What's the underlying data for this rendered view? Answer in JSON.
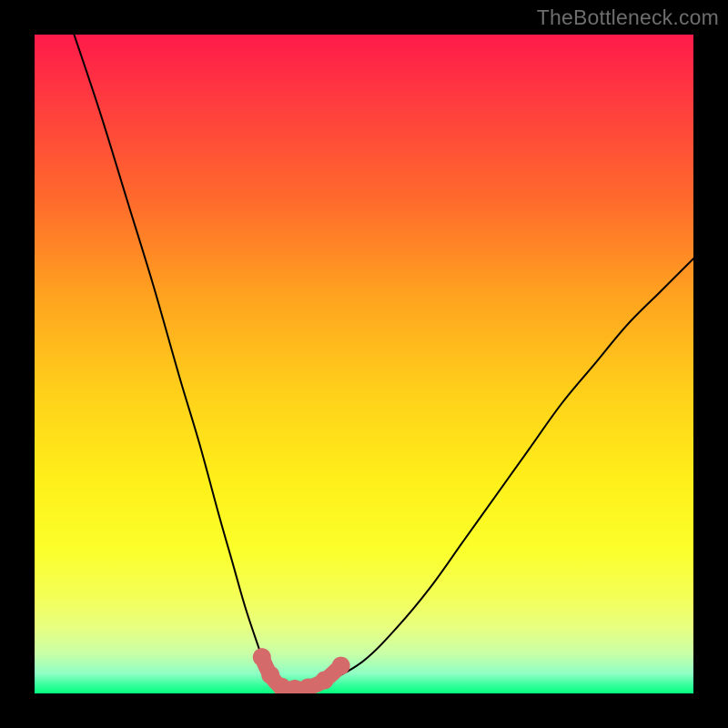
{
  "watermark": "TheBottleneck.com",
  "chart_data": {
    "type": "line",
    "title": "",
    "xlabel": "",
    "ylabel": "",
    "xlim": [
      0,
      100
    ],
    "ylim": [
      0,
      100
    ],
    "series": [
      {
        "name": "bottleneck-curve",
        "x": [
          6,
          10,
          14,
          18,
          22,
          25,
          28,
          30,
          32,
          34,
          35,
          36,
          37,
          38,
          40,
          42,
          43,
          45,
          50,
          55,
          60,
          65,
          70,
          75,
          80,
          85,
          90,
          95,
          100
        ],
        "y": [
          100,
          88,
          75,
          62,
          48,
          38,
          27,
          20,
          13,
          7,
          4,
          2,
          1,
          0.5,
          0.5,
          0.8,
          1.2,
          2,
          5,
          10,
          16,
          23,
          30,
          37,
          44,
          50,
          56,
          61,
          66
        ]
      }
    ],
    "markers": [
      {
        "name": "marker-left-1",
        "x": 34.5,
        "y": 5.5
      },
      {
        "name": "marker-left-2",
        "x": 35.8,
        "y": 2.8
      },
      {
        "name": "marker-bottom-1",
        "x": 37.5,
        "y": 1.0
      },
      {
        "name": "marker-bottom-2",
        "x": 39.5,
        "y": 0.7
      },
      {
        "name": "marker-bottom-3",
        "x": 41.5,
        "y": 0.9
      },
      {
        "name": "marker-right-1",
        "x": 44.0,
        "y": 2.0
      },
      {
        "name": "marker-right-2",
        "x": 46.5,
        "y": 4.2
      }
    ],
    "marker_color": "#d46a6a",
    "marker_radius_px": 10
  }
}
